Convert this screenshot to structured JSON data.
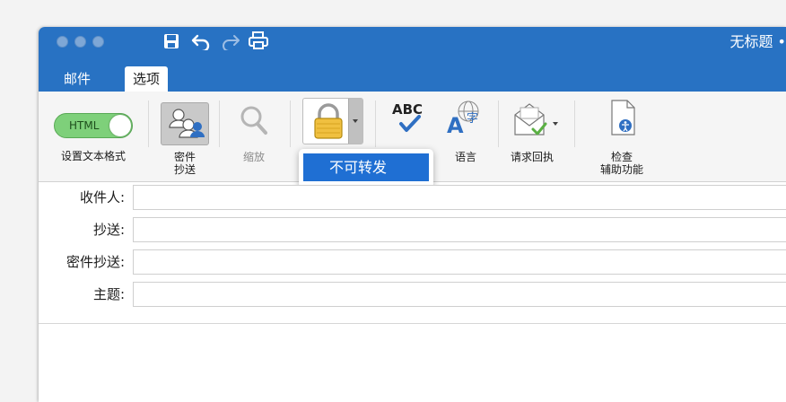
{
  "window": {
    "title": "无标题 • ",
    "quick_access": [
      {
        "name": "save-icon",
        "glyph": "🖫"
      },
      {
        "name": "undo-icon",
        "glyph": "↶"
      },
      {
        "name": "redo-icon",
        "glyph": "↷"
      },
      {
        "name": "print-icon",
        "glyph": "⎙"
      }
    ]
  },
  "tabs": [
    {
      "label": "邮件",
      "active": false
    },
    {
      "label": "选项",
      "active": true
    }
  ],
  "ribbon": {
    "format_toggle": {
      "value": "HTML",
      "label": "设置文本格式"
    },
    "bcc_label_line1": "密件",
    "bcc_label_line2": "抄送",
    "zoom_label": "缩放",
    "spelling_glyph": "ABC",
    "language_label": "语言",
    "read_receipt_label": "请求回执",
    "accessibility_line1": "检查",
    "accessibility_line2": "辅助功能"
  },
  "permission_menu": {
    "items": [
      "不可转发"
    ]
  },
  "fields": {
    "to_label": "收件人:",
    "cc_label": "抄送:",
    "bcc_label": "密件抄送:",
    "subject_label": "主题:"
  },
  "colors": {
    "titlebar": "#2872c3",
    "toggle_on": "#7ed07a",
    "menu_highlight": "#1f6fd3"
  }
}
